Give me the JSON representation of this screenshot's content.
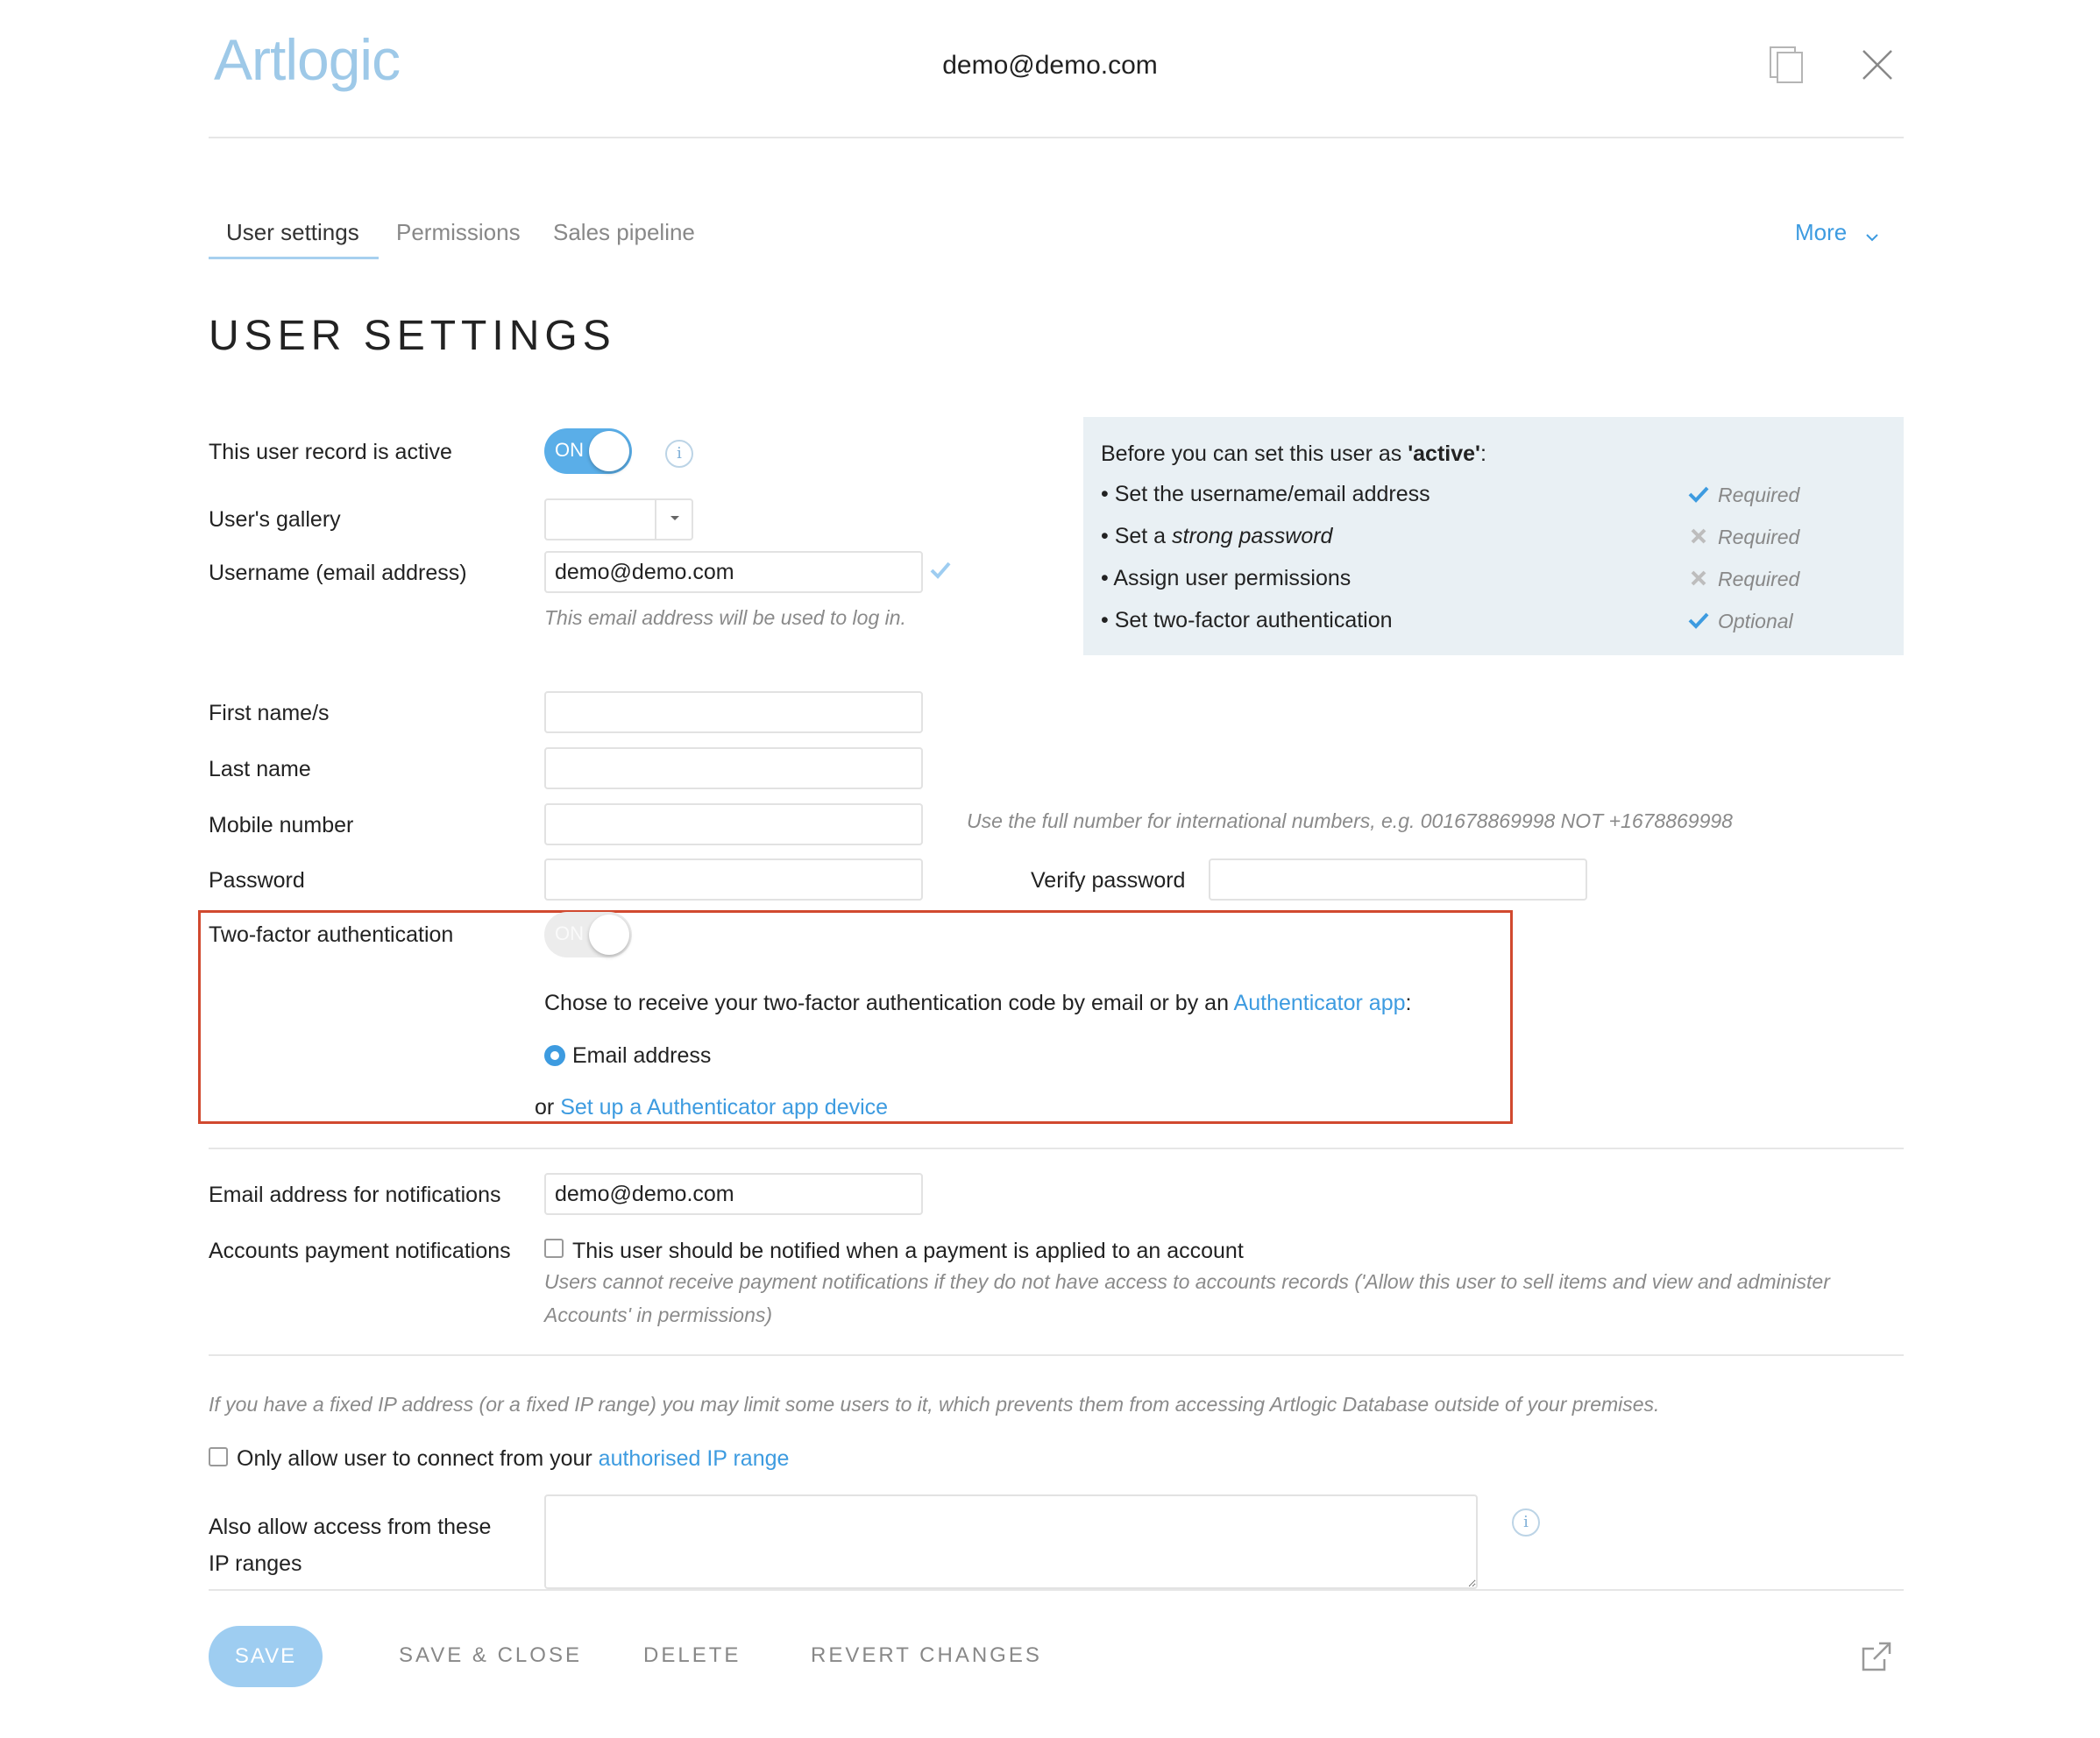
{
  "header": {
    "logo": "Artlogic",
    "email": "demo@demo.com",
    "icons": {
      "duplicate": "copy-icon",
      "close": "close-icon"
    }
  },
  "tabs": [
    {
      "label": "User settings",
      "active": true
    },
    {
      "label": "Permissions",
      "active": false
    },
    {
      "label": "Sales pipeline",
      "active": false
    }
  ],
  "more_label": "More",
  "page_title": "USER SETTINGS",
  "form": {
    "active": {
      "label": "This user record is active",
      "toggle_text": "ON",
      "on": true
    },
    "gallery": {
      "label": "User's gallery",
      "value": ""
    },
    "username": {
      "label": "Username (email address)",
      "value": "demo@demo.com",
      "hint": "This email address will be used to log in."
    },
    "first_name": {
      "label": "First name/s",
      "value": ""
    },
    "last_name": {
      "label": "Last name",
      "value": ""
    },
    "mobile": {
      "label": "Mobile number",
      "value": "",
      "hint": "Use the full number for international numbers, e.g. 001678869998 NOT +1678869998"
    },
    "password": {
      "label": "Password",
      "value": ""
    },
    "verify_password": {
      "label": "Verify password",
      "value": ""
    },
    "two_factor": {
      "label": "Two-factor authentication",
      "toggle_text": "ON",
      "on": false,
      "prompt_before": "Chose to receive your two-factor authentication code by email or by an ",
      "prompt_link": "Authenticator app",
      "prompt_after": ":",
      "option_email": "Email address",
      "or_text": "or ",
      "setup_link": "Set up a Authenticator app device"
    },
    "notify_email": {
      "label": "Email address for notifications",
      "value": "demo@demo.com"
    },
    "accounts_payment": {
      "label": "Accounts payment notifications",
      "checkbox_label": "This user should be notified when a payment is applied to an account",
      "checked": false,
      "note_line1": "Users cannot receive payment notifications if they do not have access to accounts records ('Allow this user to sell items and view and administer",
      "note_line2": "Accounts' in permissions)"
    },
    "ip": {
      "note": "If you have a fixed IP address (or a fixed IP range) you may limit some users to it, which prevents them from accessing Artlogic Database outside of your premises.",
      "checkbox_before": "Only allow user to connect from your ",
      "checkbox_link": "authorised IP range",
      "checked": false,
      "ranges_label_line1": "Also allow access from these",
      "ranges_label_line2": "IP ranges",
      "ranges_value": ""
    }
  },
  "requirements": {
    "title_before": "Before you can set this user as ",
    "title_bold": "'active'",
    "title_after": ":",
    "items": [
      {
        "label": "• Set the username/email address",
        "status": "Required",
        "met": true
      },
      {
        "label_before": "• Set a ",
        "label_em": "strong password",
        "status": "Required",
        "met": false
      },
      {
        "label": "• Assign user permissions",
        "status": "Required",
        "met": false
      },
      {
        "label": "• Set two-factor authentication",
        "status": "Optional",
        "met": true
      }
    ]
  },
  "actions": {
    "save": "SAVE",
    "save_close": "SAVE & CLOSE",
    "delete": "DELETE",
    "revert": "REVERT CHANGES",
    "external_icon": "external-link-icon"
  },
  "colors": {
    "accent": "#3d9be0",
    "highlight_border": "#d1492f",
    "panel_bg": "#e9f0f4"
  }
}
